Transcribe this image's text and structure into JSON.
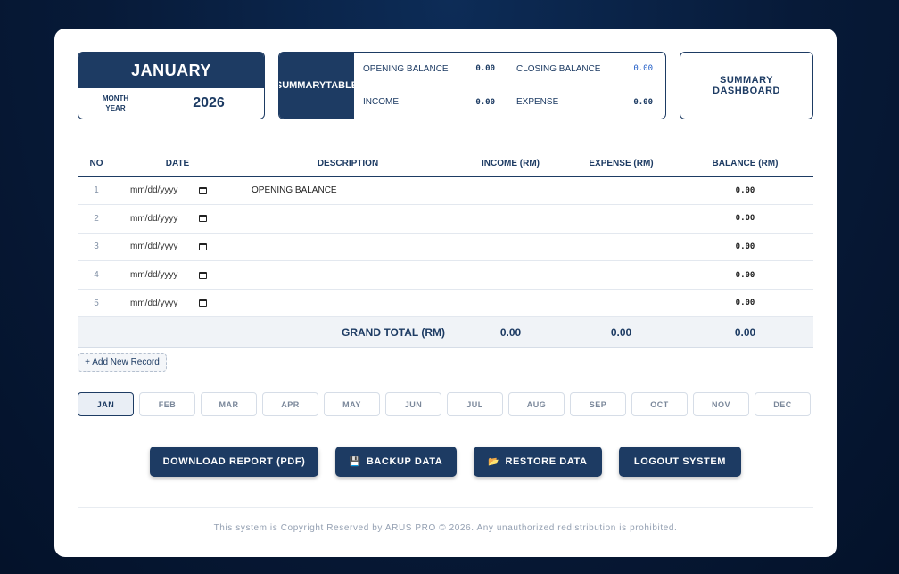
{
  "header": {
    "month": "JANUARY",
    "month_year_label_1": "MONTH",
    "month_year_label_2": "YEAR",
    "year": "2026"
  },
  "summary": {
    "title_1": "SUMMARY",
    "title_2": "TABLE",
    "opening_balance_label": "OPENING BALANCE",
    "opening_balance_value": "0.00",
    "closing_balance_label": "CLOSING BALANCE",
    "closing_balance_value": "0.00",
    "income_label": "INCOME",
    "income_value": "0.00",
    "expense_label": "EXPENSE",
    "expense_value": "0.00"
  },
  "dashboard": {
    "label_1": "SUMMARY",
    "label_2": "DASHBOARD"
  },
  "table": {
    "headers": [
      "NO",
      "DATE",
      "DESCRIPTION",
      "INCOME (RM)",
      "EXPENSE (RM)",
      "BALANCE (RM)"
    ],
    "date_placeholder": "mm/dd/yyyy",
    "rows": [
      {
        "no": "1",
        "date": "mm/dd/yyyy",
        "description": "OPENING BALANCE",
        "income": "",
        "expense": "",
        "balance": "0.00"
      },
      {
        "no": "2",
        "date": "mm/dd/yyyy",
        "description": "",
        "income": "",
        "expense": "",
        "balance": "0.00"
      },
      {
        "no": "3",
        "date": "mm/dd/yyyy",
        "description": "",
        "income": "",
        "expense": "",
        "balance": "0.00"
      },
      {
        "no": "4",
        "date": "mm/dd/yyyy",
        "description": "",
        "income": "",
        "expense": "",
        "balance": "0.00"
      },
      {
        "no": "5",
        "date": "mm/dd/yyyy",
        "description": "",
        "income": "",
        "expense": "",
        "balance": "0.00"
      }
    ],
    "grand_total_label": "GRAND TOTAL (RM)",
    "grand_total_income": "0.00",
    "grand_total_expense": "0.00",
    "grand_total_balance": "0.00"
  },
  "add_record_label": "+ Add New Record",
  "months": [
    "JAN",
    "FEB",
    "MAR",
    "APR",
    "MAY",
    "JUN",
    "JUL",
    "AUG",
    "SEP",
    "OCT",
    "NOV",
    "DEC"
  ],
  "active_month": "JAN",
  "actions": {
    "download": "DOWNLOAD REPORT (PDF)",
    "backup": "BACKUP DATA",
    "restore": "RESTORE DATA",
    "logout": "LOGOUT SYSTEM",
    "backup_icon": "floppy-disk-icon",
    "restore_icon": "folder-icon"
  },
  "footer": "This system is Copyright Reserved by ARUS PRO © 2026. Any unauthorized redistribution is prohibited.",
  "colors": {
    "primary": "#1d3b63",
    "background": "#071a38",
    "accent_value": "#1e5bc6"
  }
}
